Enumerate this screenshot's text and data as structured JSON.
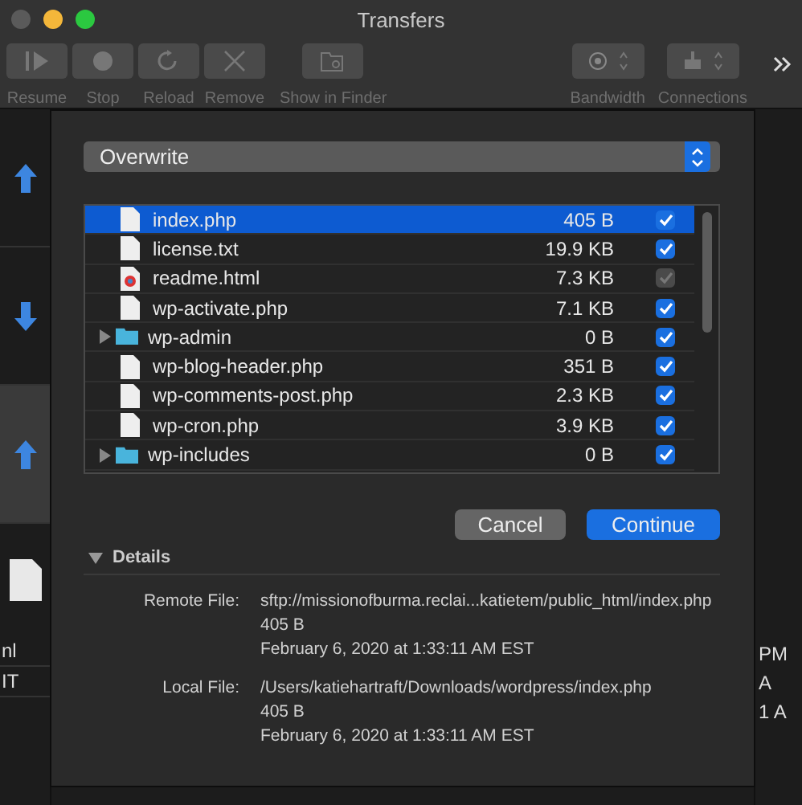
{
  "window": {
    "title": "Transfers"
  },
  "toolbar": {
    "items": [
      {
        "label": "Resume",
        "kind": "play"
      },
      {
        "label": "Stop",
        "kind": "stop"
      },
      {
        "label": "Reload",
        "kind": "reload"
      },
      {
        "label": "Remove",
        "kind": "remove"
      },
      {
        "label": "Show in Finder",
        "kind": "finder"
      }
    ],
    "menus": [
      {
        "label": "Bandwidth",
        "kind": "dial"
      },
      {
        "label": "Connections",
        "kind": "net"
      }
    ]
  },
  "transfers": [
    {
      "kind": "upload",
      "selected": false
    },
    {
      "kind": "download",
      "selected": false
    },
    {
      "kind": "upload",
      "selected": true
    }
  ],
  "background_left": [
    "nl",
    "IT"
  ],
  "background_right": [
    "PM",
    "A",
    "1 A"
  ],
  "dialog": {
    "action": "Overwrite",
    "files": [
      {
        "name": "index.php",
        "size": "405 B",
        "kind": "file",
        "checked": true,
        "disabled": false,
        "selected": true
      },
      {
        "name": "license.txt",
        "size": "19.9 KB",
        "kind": "file",
        "checked": true,
        "disabled": false,
        "selected": false
      },
      {
        "name": "readme.html",
        "size": "7.3 KB",
        "kind": "html",
        "checked": true,
        "disabled": true,
        "selected": false
      },
      {
        "name": "wp-activate.php",
        "size": "7.1 KB",
        "kind": "file",
        "checked": true,
        "disabled": false,
        "selected": false
      },
      {
        "name": "wp-admin",
        "size": "0 B",
        "kind": "folder",
        "checked": true,
        "disabled": false,
        "selected": false
      },
      {
        "name": "wp-blog-header.php",
        "size": "351 B",
        "kind": "file",
        "checked": true,
        "disabled": false,
        "selected": false
      },
      {
        "name": "wp-comments-post.php",
        "size": "2.3 KB",
        "kind": "file",
        "checked": true,
        "disabled": false,
        "selected": false
      },
      {
        "name": "wp-cron.php",
        "size": "3.9 KB",
        "kind": "file",
        "checked": true,
        "disabled": false,
        "selected": false
      },
      {
        "name": "wp-includes",
        "size": "0 B",
        "kind": "folder",
        "checked": true,
        "disabled": false,
        "selected": false
      }
    ],
    "buttons": [
      {
        "label": "Cancel",
        "kind": "secondary"
      },
      {
        "label": "Continue",
        "kind": "primary"
      }
    ],
    "details": {
      "label": "Details",
      "expanded": true,
      "entries": [
        {
          "label": "Remote File:",
          "lines": [
            "sftp://missionofburma.reclai...katietem/public_html/index.php",
            "405 B",
            "February 6, 2020 at 1:33:11 AM EST"
          ]
        },
        {
          "label": "Local File:",
          "lines": [
            "/Users/katiehartraft/Downloads/wordpress/index.php",
            "405 B",
            "February 6, 2020 at 1:33:11 AM EST"
          ]
        }
      ]
    }
  }
}
